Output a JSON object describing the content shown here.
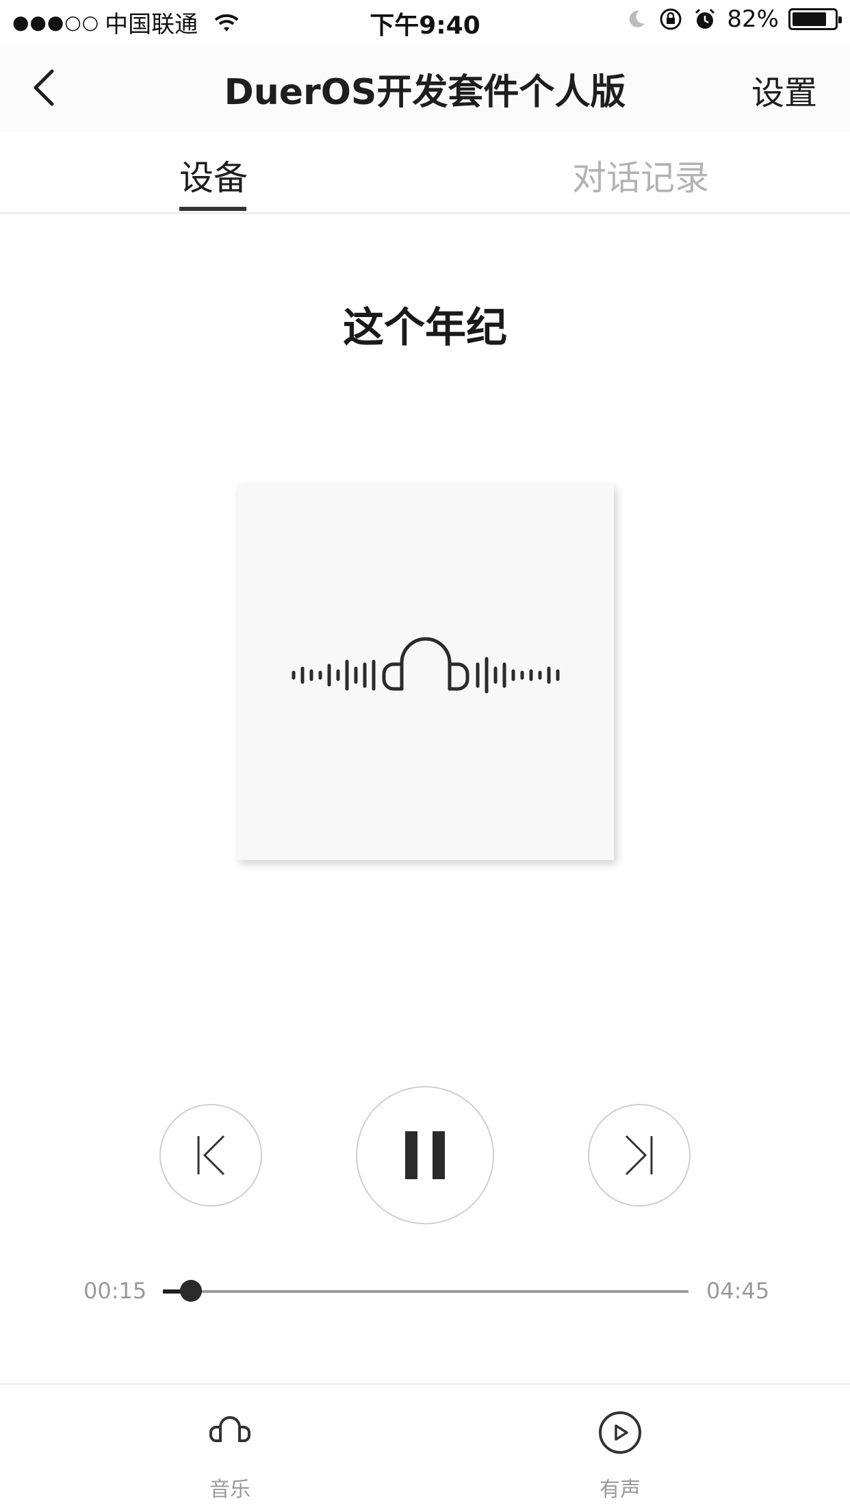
{
  "status_bar": {
    "signal": "●●●○○",
    "carrier": "中国联通",
    "time": "下午9:40",
    "battery_percent": "82%",
    "battery_level": 0.82
  },
  "nav": {
    "title": "DuerOS开发套件个人版",
    "settings_label": "设置"
  },
  "tabs": [
    {
      "label": "设备",
      "active": true
    },
    {
      "label": "对话记录",
      "active": false
    }
  ],
  "player": {
    "song_title": "这个年纪",
    "current_time": "00:15",
    "total_time": "04:45",
    "progress": 0.053,
    "state": "playing"
  },
  "bottom_tabs": [
    {
      "label": "音乐",
      "icon": "headphones-icon"
    },
    {
      "label": "有声",
      "icon": "play-circle-icon"
    }
  ],
  "colors": {
    "accent": "#333333",
    "inactive_text": "#b3b3b3",
    "track": "#9a9a9a"
  }
}
